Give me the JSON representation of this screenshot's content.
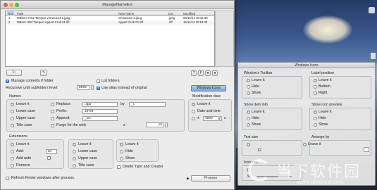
{
  "main_window": {
    "title": "ManageNameExt",
    "columns": {
      "nun": "Nun",
      "path": "Path",
      "new_name": "New Name",
      "ext": "Ext",
      "modified": "Modified"
    },
    "rows": [
      {
        "nun": "1",
        "path": "MBborn HD2 Tampon vemac104-1.jpeg",
        "new_name": "vemac104-1.jpeg",
        "ext": ".jpeg",
        "modified": "09/10/14 18:34:38"
      },
      {
        "nun": "2",
        "path": "MBorn HD2 Tampon Appart Crob 01.tiff",
        "new_name": "Appart Crob 01.tiff",
        "ext": ".tiff",
        "modified": "15/11/14 20:54:38"
      }
    ],
    "tool_buttons": {
      "add": "1↕",
      "paint": "✎",
      "help": "?",
      "f": "F",
      "star": "★"
    },
    "manage_contents": "Manage contents if folder",
    "list_folders": "List folders",
    "recursive_label": "Recursive until subfolders level:",
    "recursive_value": "9999",
    "use_alias": "Use alias instead of original",
    "windows_icons_btn": "Windows Icons",
    "names": {
      "title": "Names",
      "leave_it": "Leave it",
      "lower_case": "Lower case",
      "upper_case": "Upper case",
      "title_case": "Title case",
      "replace": "Replace:",
      "replace_value": ".app",
      "by": "by",
      "by_value": "_c",
      "prefix": "Prefix:",
      "prefix_value": "10-08",
      "append": "Append:",
      "append_value": "_src",
      "purge": "Purge for the web",
      "z": "z",
      "z_value": "10"
    },
    "modification": {
      "title": "Modification date",
      "leave_it": "Leave it",
      "date_time": "Date and time",
      "plus": "±",
      "plus_value": "3600",
      "s": "s"
    },
    "extensions": {
      "title": "Extensions",
      "leave_it": "Leave it",
      "add": "Add:",
      "add_value": "txt",
      "add_auto": "Add auto",
      "remove": "Remove",
      "col2": [
        "Leave it",
        "Lower case",
        "Upper case",
        "Title case"
      ],
      "col3": [
        "Leave it",
        "Hide",
        "Show"
      ],
      "delete_type": "Delete Type and Creator"
    },
    "refresh": "Refresh Finder windows after process.",
    "process": "Process"
  },
  "icons_panel": {
    "title": "Windows Icons",
    "toolbar": {
      "title": "Window's Toolbar",
      "options": [
        "Leave it",
        "Hide",
        "Show"
      ]
    },
    "label_position": {
      "title": "Label position",
      "options": [
        "Leave it",
        "Bottom",
        "Right"
      ]
    },
    "show_item_info": {
      "title": "Show item info",
      "options": [
        "Leave it",
        "Hide",
        "Show"
      ]
    },
    "show_icon_preview": {
      "title": "Show icon preview",
      "options": [
        "Leave it",
        "Hide",
        "Show"
      ]
    },
    "text_size": {
      "title": "Text size",
      "value": "12"
    },
    "arrange_by": {
      "title": "Arrange by",
      "value": "Leave it"
    },
    "icon_size": {
      "title": "Icon size",
      "value": "32"
    }
  },
  "watermark": {
    "cn": "当下软件园",
    "url": "www.downxia.com"
  },
  "colors": {
    "accent": "#3a7fe0",
    "window_bg": "#ececec"
  }
}
